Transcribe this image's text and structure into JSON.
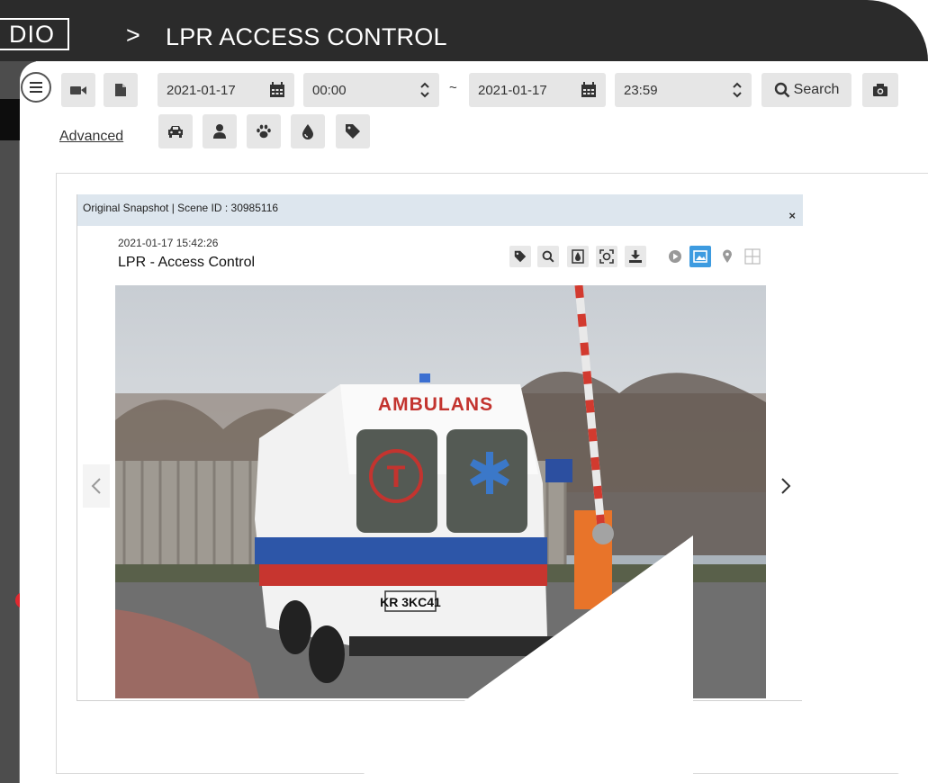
{
  "header": {
    "brand": "DIO",
    "separator": ">",
    "title": "LPR ACCESS CONTROL"
  },
  "toolbar": {
    "start_date": "2021-01-17",
    "start_time": "00:00",
    "range_separator": "~",
    "end_date": "2021-01-17",
    "end_time": "23:59",
    "search_label": "Search",
    "advanced_label": "Advanced",
    "filter_icons": [
      "car-icon",
      "person-icon",
      "paw-icon",
      "color-drop-icon",
      "tag-icon"
    ]
  },
  "snapshot": {
    "header_text": "Original Snapshot | Scene ID : 30985116",
    "close_label": "×",
    "timestamp": "2021-01-17 15:42:26",
    "label": "LPR - Access Control",
    "tools": [
      "tag-icon",
      "search-icon",
      "color-icon",
      "face-scan-icon",
      "download-icon",
      "play-icon",
      "image-icon",
      "location-icon",
      "layout-icon"
    ]
  },
  "photo": {
    "vehicle_text": "AMBULANS",
    "plate_text": "KR 3KC41"
  },
  "alerts": {
    "badge": "!"
  },
  "colors": {
    "topbar": "#2b2b2b",
    "snapshot_header": "#dde6ee",
    "active_tool": "#3d9be0",
    "alert": "#e0282f"
  }
}
